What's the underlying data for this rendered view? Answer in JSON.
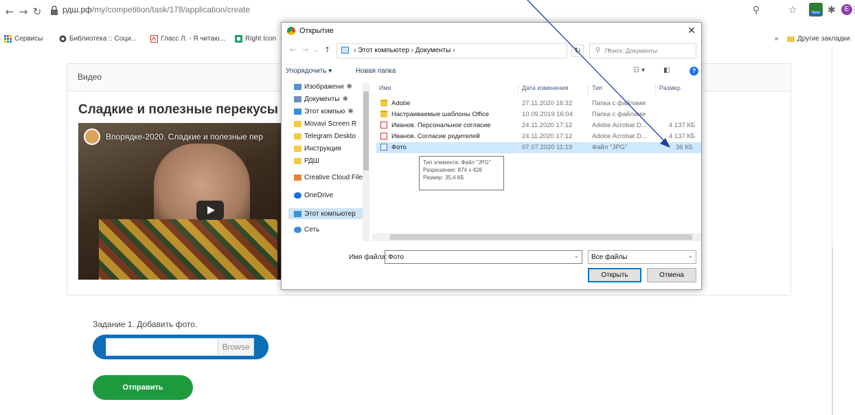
{
  "browser": {
    "url_host": "рдш.рф",
    "url_path": "/my/competition/task/178/application/create",
    "bookmarks": [
      {
        "label": "Сервисы",
        "icon": "apps-grid-icon"
      },
      {
        "label": "Библиотека :: Соци...",
        "icon": "globe-icon"
      },
      {
        "label": "Гласс Л. - Я читаю...",
        "icon": "pdf-icon"
      },
      {
        "label": "Right Icon",
        "icon": "green-square-icon"
      }
    ],
    "bookmarks_right": {
      "overflow": "»",
      "other": "Другие закладки"
    },
    "avatar_letter": "E",
    "ext_badge": "New"
  },
  "page": {
    "card_header": "Видео",
    "video_heading": "Сладкие и полезные перекусы",
    "video_title_overlay": "Впорядке-2020. Сладкие и полезные пер",
    "task_label": "Задание 1. Добавить фото.",
    "browse_label": "Browse",
    "submit_label": "Отправить"
  },
  "dialog": {
    "title": "Открытие",
    "breadcrumb": "›  Этот компьютер  ›  Документы  ›",
    "search_placeholder": "Поиск: Документы",
    "organize_label": "Упорядочить ▾",
    "new_folder_label": "Новая папка",
    "nav_items": [
      {
        "label": "Изображени",
        "pin": "✱",
        "icon": "images-icon",
        "color": "#5b8fd6"
      },
      {
        "label": "Документы",
        "pin": "✱",
        "icon": "documents-icon",
        "color": "#6e8fb8"
      },
      {
        "label": "Этот компью",
        "pin": "✱",
        "icon": "computer-icon",
        "color": "#3a8fd8"
      },
      {
        "label": "Movavi Screen R",
        "pin": "",
        "icon": "folder-icon",
        "color": "#f2c94c"
      },
      {
        "label": "Telegram Deskto",
        "pin": "",
        "icon": "folder-icon",
        "color": "#f2c94c"
      },
      {
        "label": "Инструкция",
        "pin": "",
        "icon": "folder-icon",
        "color": "#f2c94c"
      },
      {
        "label": "РДШ",
        "pin": "",
        "icon": "folder-icon",
        "color": "#f2c94c"
      },
      {
        "label": "Creative Cloud File",
        "pin": "",
        "icon": "creative-cloud-icon",
        "color": "#e8833a"
      },
      {
        "label": "OneDrive",
        "pin": "",
        "icon": "onedrive-icon",
        "color": "#1d6fd6"
      },
      {
        "label": "Этот компьютер",
        "pin": "",
        "icon": "computer-icon",
        "color": "#3a8fd8"
      },
      {
        "label": "Сеть",
        "pin": "",
        "icon": "network-icon",
        "color": "#3a8fd8"
      }
    ],
    "columns": {
      "name": "Имя",
      "date": "Дата изменения",
      "type": "Тип",
      "size": "Размер"
    },
    "files": [
      {
        "name": "Adobe",
        "date": "27.11.2020 16:32",
        "type": "Папка с файлами",
        "size": "",
        "kind": "folder"
      },
      {
        "name": "Настраиваемые шаблоны Office",
        "date": "10.09.2019 16:04",
        "type": "Папка с файлами",
        "size": "",
        "kind": "folder"
      },
      {
        "name": "Иванов. Персональное согласие",
        "date": "24.11.2020 17:12",
        "type": "Adobe Acrobat D...",
        "size": "4 137 КБ",
        "kind": "pdf"
      },
      {
        "name": "Иванов. Согласие родителей",
        "date": "24.11.2020 17:12",
        "type": "Adobe Acrobat D...",
        "size": "4 137 КБ",
        "kind": "pdf"
      },
      {
        "name": "Фото",
        "date": "07.07.2020 11:19",
        "type": "Файл \"JPG\"",
        "size": "36 КБ",
        "kind": "jpg"
      }
    ],
    "tooltip": {
      "line1": "Тип элемента: Файл \"JPG\"",
      "line2": "Разрешение: 874 x 428",
      "line3": "Размер: 35,4 КБ"
    },
    "filename_label": "Имя файла:",
    "filename_value": "Фото",
    "filetype_value": "Все файлы",
    "open_label": "Открыть",
    "cancel_label": "Отмена"
  },
  "annotation": {
    "arrow_color": "#1c3fa8"
  }
}
